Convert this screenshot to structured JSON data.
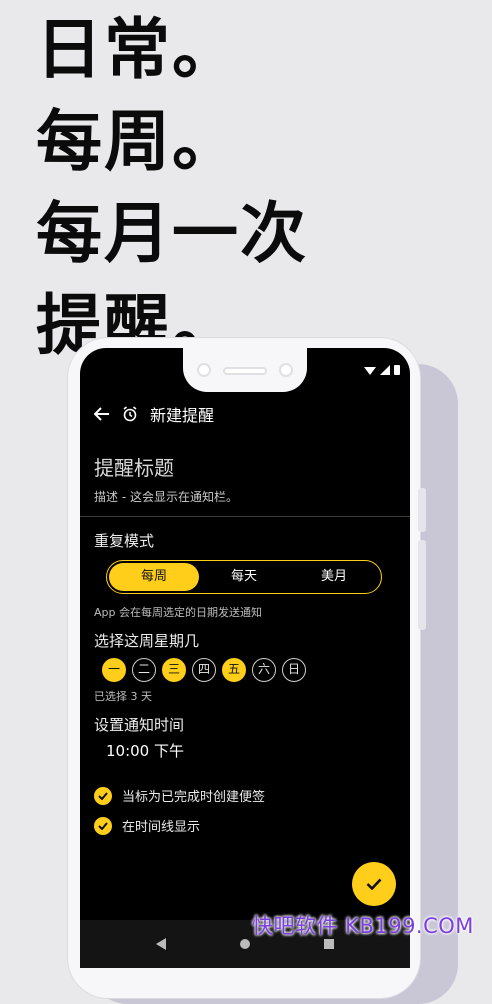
{
  "headline": [
    "日常。",
    "每周。",
    "每月一次",
    "提醒。"
  ],
  "app_bar": {
    "title": "新建提醒"
  },
  "form": {
    "title_placeholder": "提醒标题",
    "description_hint": "描述 - 这会显示在通知栏。"
  },
  "repeat": {
    "label": "重复模式",
    "options": [
      "每周",
      "每天",
      "美月"
    ],
    "selected": "每周",
    "hint": "App 会在每周选定的日期发送通知"
  },
  "weekdays": {
    "label": "选择这周星期几",
    "days": [
      {
        "label": "一",
        "selected": true
      },
      {
        "label": "二",
        "selected": false
      },
      {
        "label": "三",
        "selected": true
      },
      {
        "label": "四",
        "selected": false
      },
      {
        "label": "五",
        "selected": true
      },
      {
        "label": "六",
        "selected": false
      },
      {
        "label": "日",
        "selected": false
      }
    ],
    "count_text": "已选择 3 天"
  },
  "time": {
    "label": "设置通知时间",
    "value": "10:00 下午"
  },
  "options": {
    "create_note": "当标为已完成时创建便签",
    "show_timeline": "在时间线显示"
  },
  "icons": {
    "back": "arrow-left-icon",
    "alarm": "alarm-clock-icon",
    "check": "check-icon",
    "save": "check-icon"
  },
  "colors": {
    "accent": "#ffce1a",
    "background": "#000000",
    "page": "#e9e8ea"
  },
  "watermark": "快吧软件 KB199.COM"
}
